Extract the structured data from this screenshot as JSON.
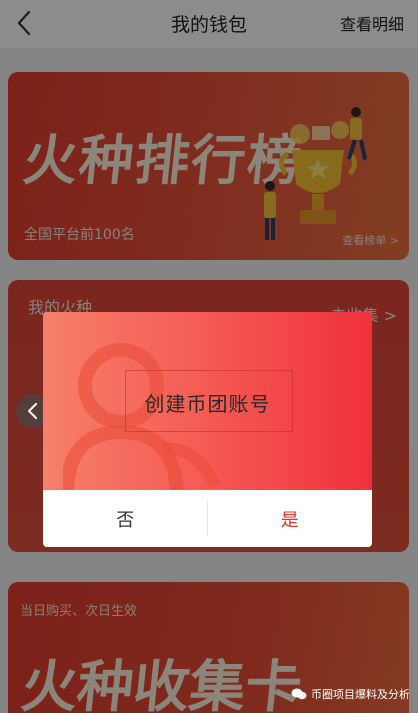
{
  "nav": {
    "title": "我的钱包",
    "detail_label": "查看明细"
  },
  "rank_card": {
    "headline": "火种排行榜",
    "subtitle": "全国平台前100名",
    "link_label": "查看榜单 >"
  },
  "huozhong_card": {
    "heading": "我的火种",
    "collect_label": "去收集 >"
  },
  "bottom_card": {
    "note": "当日购买、次日生效",
    "headline": "火种收集卡"
  },
  "modal": {
    "message": "创建币团账号",
    "no_label": "否",
    "yes_label": "是"
  },
  "watermark": {
    "text": "币圈项目爆料及分析"
  },
  "colors": {
    "accent_red": "#e2362c",
    "card_red": "#e23d2f",
    "overlay": "rgba(0,0,0,0.45)"
  }
}
